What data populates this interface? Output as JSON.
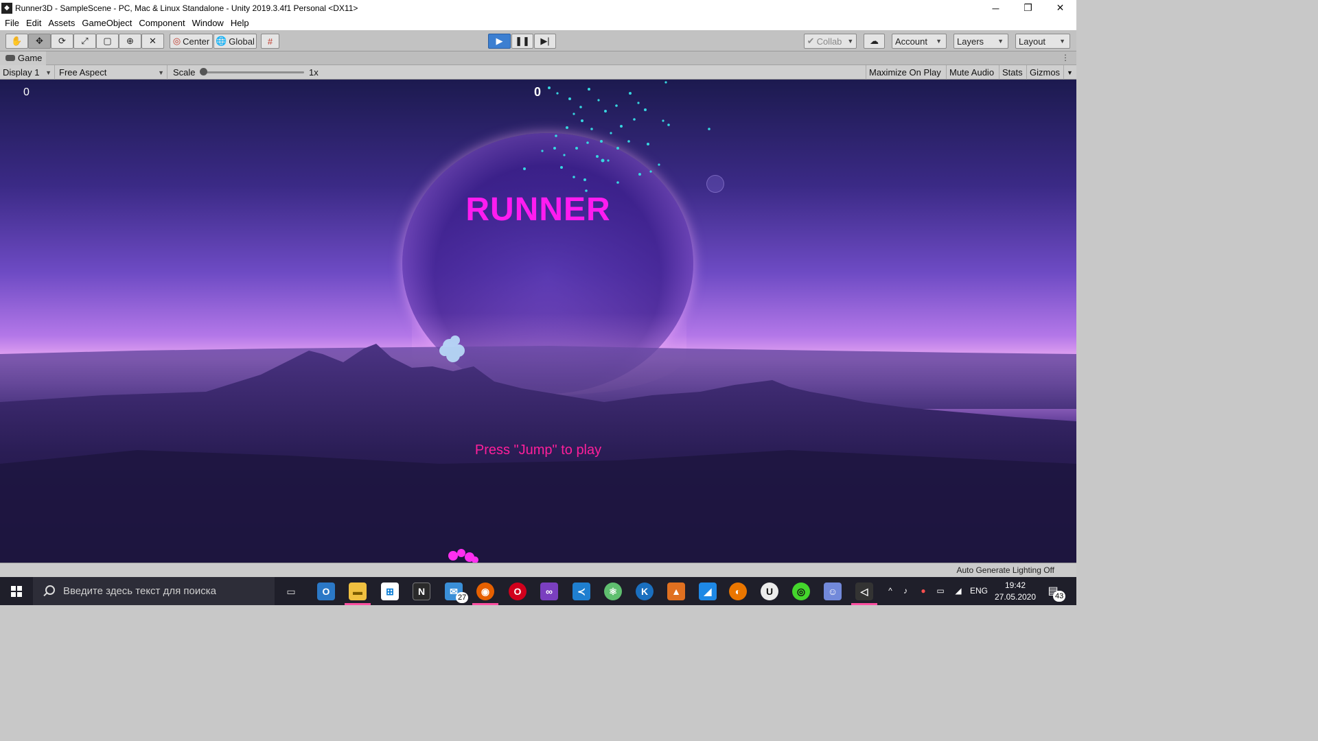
{
  "window": {
    "title": "Runner3D - SampleScene - PC, Mac & Linux Standalone - Unity 2019.3.4f1 Personal <DX11>",
    "minimize": "─",
    "restore": "❐",
    "close": "✕"
  },
  "menu": [
    "File",
    "Edit",
    "Assets",
    "GameObject",
    "Component",
    "Window",
    "Help"
  ],
  "toolbar": {
    "tools": [
      "hand-tool",
      "move-tool",
      "rotate-tool",
      "scale-tool",
      "rect-tool",
      "transform-tool",
      "custom-tool"
    ],
    "pivot_label": "Center",
    "space_label": "Global",
    "collab_label": "Collab",
    "account_label": "Account",
    "layers_label": "Layers",
    "layout_label": "Layout"
  },
  "panel": {
    "tab_label": "Game",
    "display_label": "Display 1",
    "aspect_label": "Free Aspect",
    "scale_label": "Scale",
    "scale_value": "1x",
    "scale_level": 0,
    "maximize_label": "Maximize On Play",
    "mute_label": "Mute Audio",
    "stats_label": "Stats",
    "gizmos_label": "Gizmos"
  },
  "game": {
    "score_left": "0",
    "score_center": "0",
    "title": "RUNNER",
    "prompt": "Press \"Jump\" to play",
    "title_color": "#ff1cf0",
    "prompt_color": "#ff1f9a"
  },
  "status": {
    "text": "Auto Generate Lighting Off"
  },
  "taskbar": {
    "search_placeholder": "Введите здесь текст для поиска",
    "mail_badge": "27",
    "lang": "ENG",
    "time": "19:42",
    "date": "27.05.2020",
    "notifications": "43",
    "apps": [
      "task-view",
      "outlook",
      "file-explorer",
      "store",
      "notion",
      "mail",
      "firefox",
      "opera",
      "visual-studio",
      "vscode",
      "atom",
      "gitkraken",
      "matlab",
      "sharkey",
      "blender",
      "unreal",
      "razer",
      "discord",
      "unity"
    ]
  }
}
